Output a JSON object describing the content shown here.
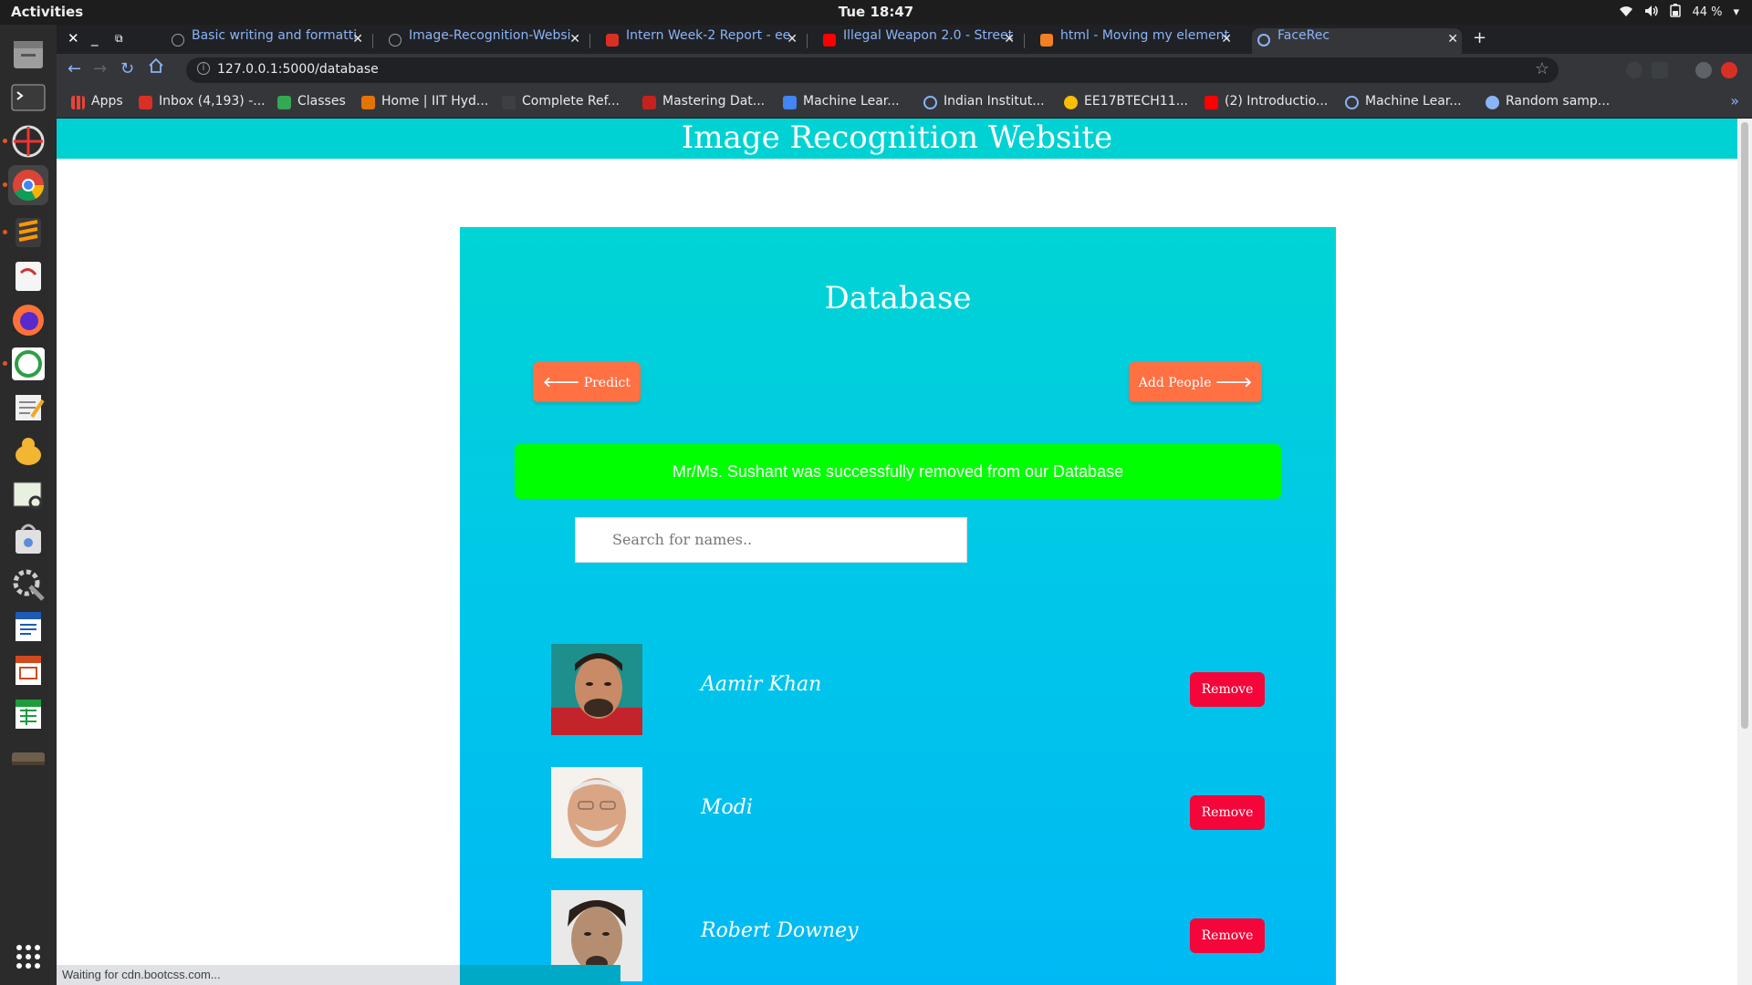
{
  "system": {
    "activities": "Activities",
    "clock": "Tue 18:47",
    "battery": "44 %"
  },
  "browser": {
    "tabs": [
      {
        "title": "Basic writing and formatti",
        "favicon_color": "#202124"
      },
      {
        "title": "Image-Recognition-Websi",
        "favicon_color": "#202124"
      },
      {
        "title": "Intern Week-2 Report - ee",
        "favicon_color": "#d93025"
      },
      {
        "title": "Illegal Weapon 2.0 - Street",
        "favicon_color": "#ff0000"
      },
      {
        "title": "html - Moving my element",
        "favicon_color": "#f48024"
      },
      {
        "title": "FaceRec",
        "favicon_color": "#8ab4f8"
      }
    ],
    "url": "127.0.0.1:5000/database",
    "bookmarks": [
      {
        "label": "Apps",
        "icon_color": "#ea4335"
      },
      {
        "label": "Inbox (4,193) -...",
        "icon_color": "#d93025"
      },
      {
        "label": "Classes",
        "icon_color": "#34a853"
      },
      {
        "label": "Home | IIT Hyd...",
        "icon_color": "#e37400"
      },
      {
        "label": "Complete Ref...",
        "icon_color": "#3c4043"
      },
      {
        "label": "Mastering Dat...",
        "icon_color": "#c5221f"
      },
      {
        "label": "Machine Lear...",
        "icon_color": "#4285f4"
      },
      {
        "label": "Indian Institut...",
        "icon_color": "#8ab4f8"
      },
      {
        "label": "EE17BTECH11...",
        "icon_color": "#fbbc04"
      },
      {
        "label": "(2) Introductio...",
        "icon_color": "#ff0000"
      },
      {
        "label": "Machine Lear...",
        "icon_color": "#8ab4f8"
      },
      {
        "label": "Random samp...",
        "icon_color": "#8ab4f8"
      }
    ],
    "status": "Waiting for cdn.bootcss.com..."
  },
  "page": {
    "site_title": "Image Recognition Website",
    "card_title": "Database",
    "predict_label": "Predict",
    "add_people_label": "Add People",
    "alert": "Mr/Ms. Sushant was successfully removed from our Database",
    "search_placeholder": "Search for names..",
    "people": [
      {
        "name": "Aamir Khan",
        "remove_label": "Remove"
      },
      {
        "name": "Modi",
        "remove_label": "Remove"
      },
      {
        "name": "Robert Downey",
        "remove_label": "Remove"
      }
    ]
  },
  "colors": {
    "header": "#00d2d3",
    "button_orange": "#ff7043",
    "alert_green": "#00ff00",
    "remove_red": "#f4063a"
  }
}
